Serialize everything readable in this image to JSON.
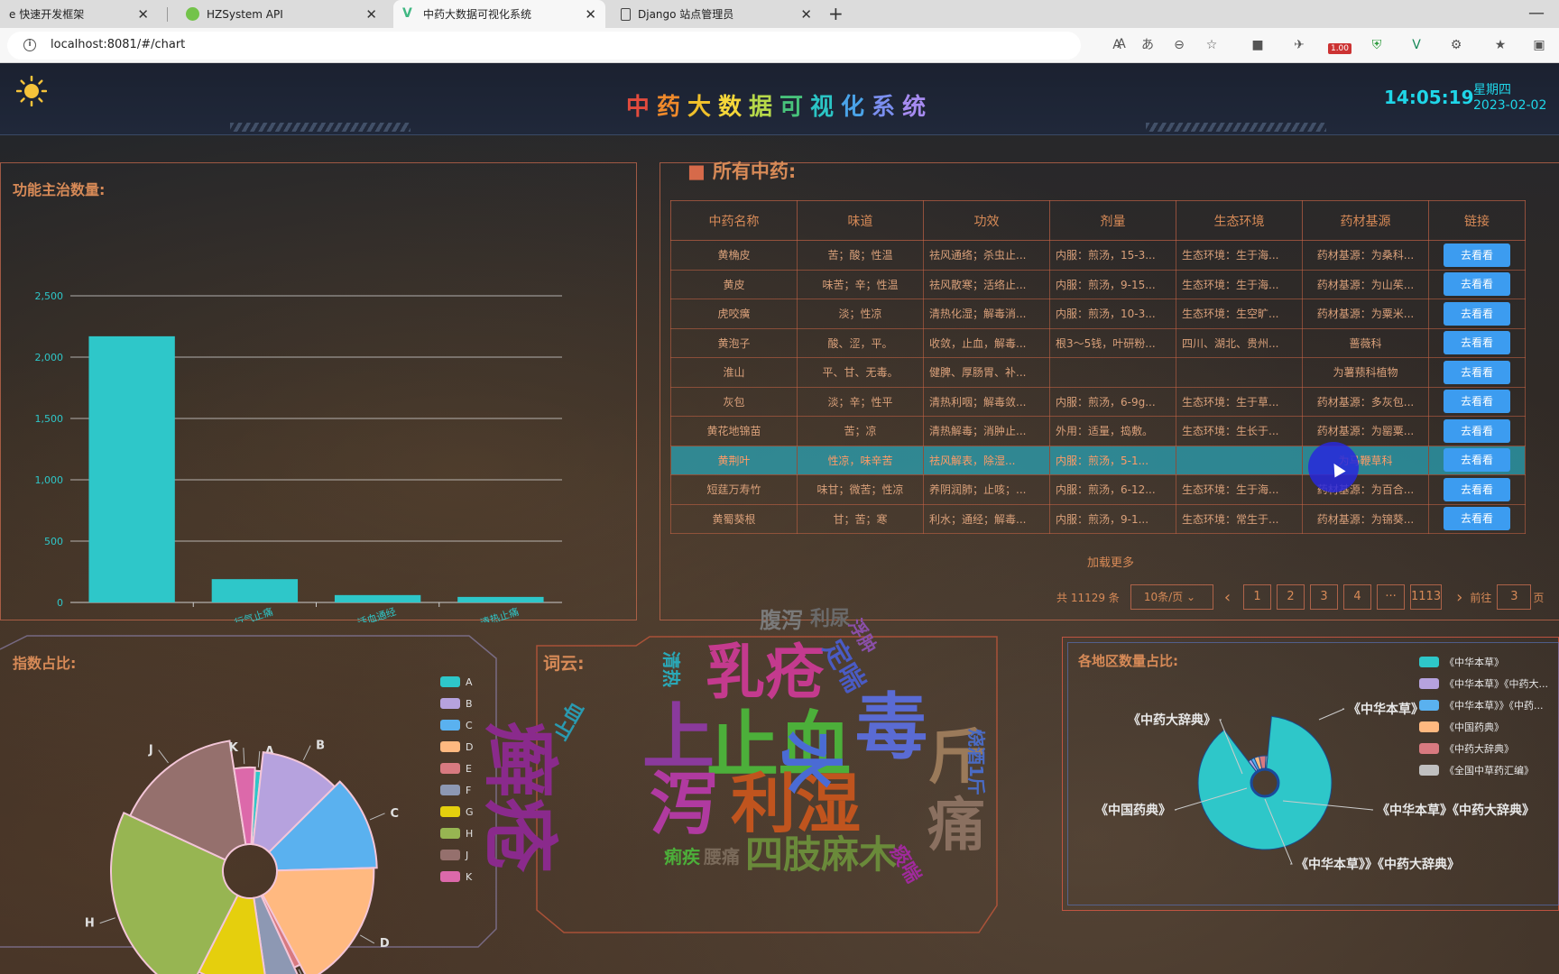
{
  "browser": {
    "tabs": [
      {
        "title": "e 快速开发框架",
        "icon_color": "#ffffff",
        "active": false
      },
      {
        "title": "HZSystem API",
        "icon_color": "#73c34a",
        "active": false
      },
      {
        "title": "中药大数据可视化系统",
        "icon_color": "#41b883",
        "active": true
      },
      {
        "title": "Django 站点管理员",
        "icon_color": "#ffffff",
        "active": false
      }
    ],
    "url": "localhost:8081/#/chart",
    "badge_value": "1.00"
  },
  "header": {
    "title_chars": [
      "中",
      "药",
      "大",
      "数",
      "据",
      "可",
      "视",
      "化",
      "系",
      "统"
    ],
    "title_colors": [
      "#e34b3d",
      "#f08a2b",
      "#f0c02b",
      "#f5d73a",
      "#b7d94a",
      "#48c27b",
      "#2bc5c5",
      "#4aa3e8",
      "#7b8ff0",
      "#a68bf0"
    ],
    "time": "14:05:19",
    "weekday": "星期四",
    "date": "2023-02-02"
  },
  "bar_panel": {
    "title": "功能主治数量:",
    "chart_data": {
      "type": "bar",
      "categories": [
        "",
        "行气止痛",
        "活血通经",
        "清热止痛"
      ],
      "values": [
        2170,
        190,
        60,
        45
      ],
      "y_ticks": [
        0,
        500,
        1000,
        1500,
        2000,
        2500
      ],
      "ylim": [
        0,
        2500
      ],
      "color": "#2ec7c9",
      "datazoom": true
    }
  },
  "table_panel": {
    "title": "所有中药:",
    "columns": [
      "中药名称",
      "味道",
      "功效",
      "剂量",
      "生态环境",
      "药材基源",
      "链接"
    ],
    "rows": [
      [
        "黄桷皮",
        "苦；酸；性温",
        "祛风通络；杀虫止...",
        "内服：煎汤，15-3...",
        "生态环境：生于海...",
        "药材基源：为桑科...",
        "去看看"
      ],
      [
        "黄皮",
        "味苦；辛；性温",
        "祛风散寒；活络止...",
        "内服：煎汤，9-15...",
        "生态环境：生于海...",
        "药材基源：为山茱...",
        "去看看"
      ],
      [
        "虎咬癀",
        "淡；性凉",
        "清热化湿；解毒消...",
        "内服：煎汤，10-3...",
        "生态环境：生空旷...",
        "药材基源：为粟米...",
        "去看看"
      ],
      [
        "黄泡子",
        "酸、涩，平。",
        "收敛，止血，解毒...",
        "根3～5钱，叶研粉...",
        "四川、湖北、贵州...",
        "蔷薇科",
        "去看看"
      ],
      [
        "淮山",
        "平、甘、无毒。",
        "健脾、厚肠胃、补...",
        "",
        "",
        "为薯蓣科植物",
        "去看看"
      ],
      [
        "灰包",
        "淡；辛；性平",
        "清热利咽；解毒敛...",
        "内服：煎汤，6-9g...",
        "生态环境：生于草...",
        "药材基源：多灰包...",
        "去看看"
      ],
      [
        "黄花地锦苗",
        "苦；凉",
        "清热解毒；消肿止...",
        "外用：适量，捣敷。",
        "生态环境：生长于...",
        "药材基源：为罂粟...",
        "去看看"
      ],
      [
        "黄荆叶",
        "性凉，味辛苦",
        "祛风解表，除湿...",
        "内服：煎汤，5-1...",
        "",
        "为马鞭草科",
        "去看看"
      ],
      [
        "短莛万寿竹",
        "味甘；微苦；性凉",
        "养阴润肺；止咳；...",
        "内服：煎汤，6-12...",
        "生态环境：生于海...",
        "药材基源：为百合...",
        "去看看"
      ],
      [
        "黄蜀葵根",
        "甘；苦；寒",
        "利水；通经；解毒...",
        "内服：煎汤，9-1...",
        "生态环境：常生于...",
        "药材基源：为锦葵...",
        "去看看"
      ]
    ],
    "highlight_row": 7,
    "load_more": "加载更多",
    "pagination": {
      "total": "共 11129 条",
      "page_size": "10条/页",
      "pages": [
        "1",
        "2",
        "3",
        "4",
        "···",
        "1113"
      ],
      "goto_label": "前往",
      "goto_value": "3",
      "page_unit": "页"
    }
  },
  "pie_panel": {
    "title": "指数占比:",
    "chart_data": {
      "type": "pie",
      "labels": [
        "A",
        "B",
        "C",
        "D",
        "E",
        "F",
        "G",
        "H",
        "J",
        "K"
      ],
      "values": [
        3,
        33,
        37,
        54,
        3,
        14,
        30,
        75,
        48,
        10
      ],
      "colors": [
        "#2ec7c9",
        "#b6a2de",
        "#5ab1ef",
        "#ffb980",
        "#d87a80",
        "#8d98b3",
        "#e5cf0d",
        "#97b552",
        "#95706d",
        "#dc69aa"
      ]
    }
  },
  "wordcloud_panel": {
    "title": "词云:",
    "words": [
      {
        "text": "腹泻",
        "color": "#7a7a7a"
      },
      {
        "text": "利尿",
        "color": "#6a6a6a"
      },
      {
        "text": "浮肿",
        "color": "#8a4fa8"
      },
      {
        "text": "乳疮",
        "color": "#c43a8e"
      },
      {
        "text": "定喘",
        "color": "#4a5bc4"
      },
      {
        "text": "清热",
        "color": "#2aa9b8"
      },
      {
        "text": "上",
        "color": "#8a3a9c"
      },
      {
        "text": "止血",
        "color": "#4caf3a"
      },
      {
        "text": "毒",
        "color": "#5a6bd4"
      },
      {
        "text": "止血",
        "color": "#2a9ab0"
      },
      {
        "text": "癣疮",
        "color": "#8a2a8c"
      },
      {
        "text": "泻",
        "color": "#b03aa0"
      },
      {
        "text": "利湿",
        "color": "#c0541e"
      },
      {
        "text": "水",
        "color": "#4a6bd4"
      },
      {
        "text": "斤",
        "color": "#9a7a5a"
      },
      {
        "text": "痛",
        "color": "#8a7060"
      },
      {
        "text": "烧酒1斤",
        "color": "#4a6bc4"
      },
      {
        "text": "四肢麻木",
        "color": "#6a8a3a"
      },
      {
        "text": "腰痛",
        "color": "#7a6a5a"
      },
      {
        "text": "痢疾",
        "color": "#4caf3a"
      },
      {
        "text": "痰喘",
        "color": "#a02a9c"
      }
    ]
  },
  "region_panel": {
    "title": "各地区数量占比:",
    "chart_data": {
      "type": "pie",
      "labels": [
        "《中华本草》",
        "《中华本草》《中药大辞典》",
        "《中华本草》》《中药大辞典》",
        "《中国药典》",
        "《中药大辞典》",
        "《全国中草药汇编》"
      ],
      "legend_labels": [
        "《中华本草》",
        "《中华本草》《中药大...",
        "《中华本草》》《中药...",
        "《中国药典》",
        "《中药大辞典》",
        "《全国中草药汇编》"
      ],
      "values": [
        88,
        2,
        2,
        3,
        4,
        1
      ],
      "colors": [
        "#2ec7c9",
        "#b6a2de",
        "#5ab1ef",
        "#ffb980",
        "#d87a80",
        "#c0c0c0"
      ]
    }
  }
}
